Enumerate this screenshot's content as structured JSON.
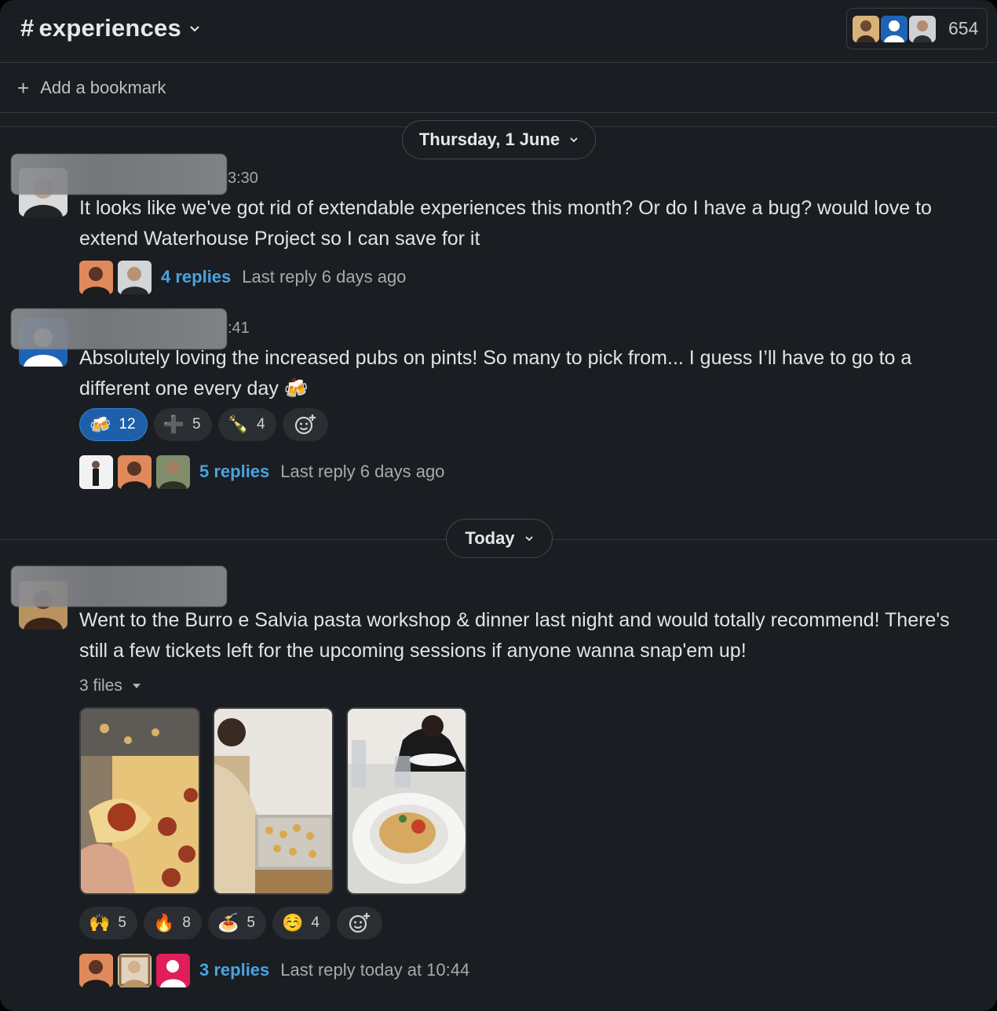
{
  "channel": {
    "name": "experiences",
    "member_count": "654"
  },
  "bookmark": {
    "label": "Add a bookmark"
  },
  "dividers": [
    {
      "label": "Thursday, 1 June"
    },
    {
      "label": "Today"
    }
  ],
  "messages": [
    {
      "time_fragment": "3:30",
      "text": "It looks like we've got rid of extendable experiences this month? Or do I have a bug? would love to extend Waterhouse Project so I can save for it",
      "thread": {
        "replies": "4 replies",
        "last_reply": "Last reply 6 days ago"
      }
    },
    {
      "time_fragment": ":41",
      "text": "Absolutely loving the increased pubs on pints! So many to pick from... I guess I’ll have to go to a different one every day 🍻",
      "reactions": [
        {
          "emoji": "🍻",
          "count": "12",
          "active": true
        },
        {
          "emoji": "➕",
          "count": "5"
        },
        {
          "emoji": "🍾",
          "count": "4"
        }
      ],
      "thread": {
        "replies": "5 replies",
        "last_reply": "Last reply 6 days ago"
      }
    },
    {
      "text": "Went to the Burro e Salvia pasta workshop & dinner last night and would totally recommend! There's still a few tickets left for the upcoming sessions if anyone wanna snap'em up!",
      "files_label": "3 files",
      "reactions": [
        {
          "emoji": "🙌",
          "count": "5"
        },
        {
          "emoji": "🔥",
          "count": "8"
        },
        {
          "emoji": "🍝",
          "count": "5"
        },
        {
          "emoji": "☺️",
          "count": "4"
        }
      ],
      "thread": {
        "replies": "3 replies",
        "last_reply": "Last reply today at 10:44"
      }
    }
  ],
  "icons": {
    "hash": "hash-icon",
    "chevron": "chevron-down-icon",
    "plus": "plus-icon",
    "add_reaction": "add-reaction-icon",
    "files_toggle": "caret-down-icon"
  }
}
